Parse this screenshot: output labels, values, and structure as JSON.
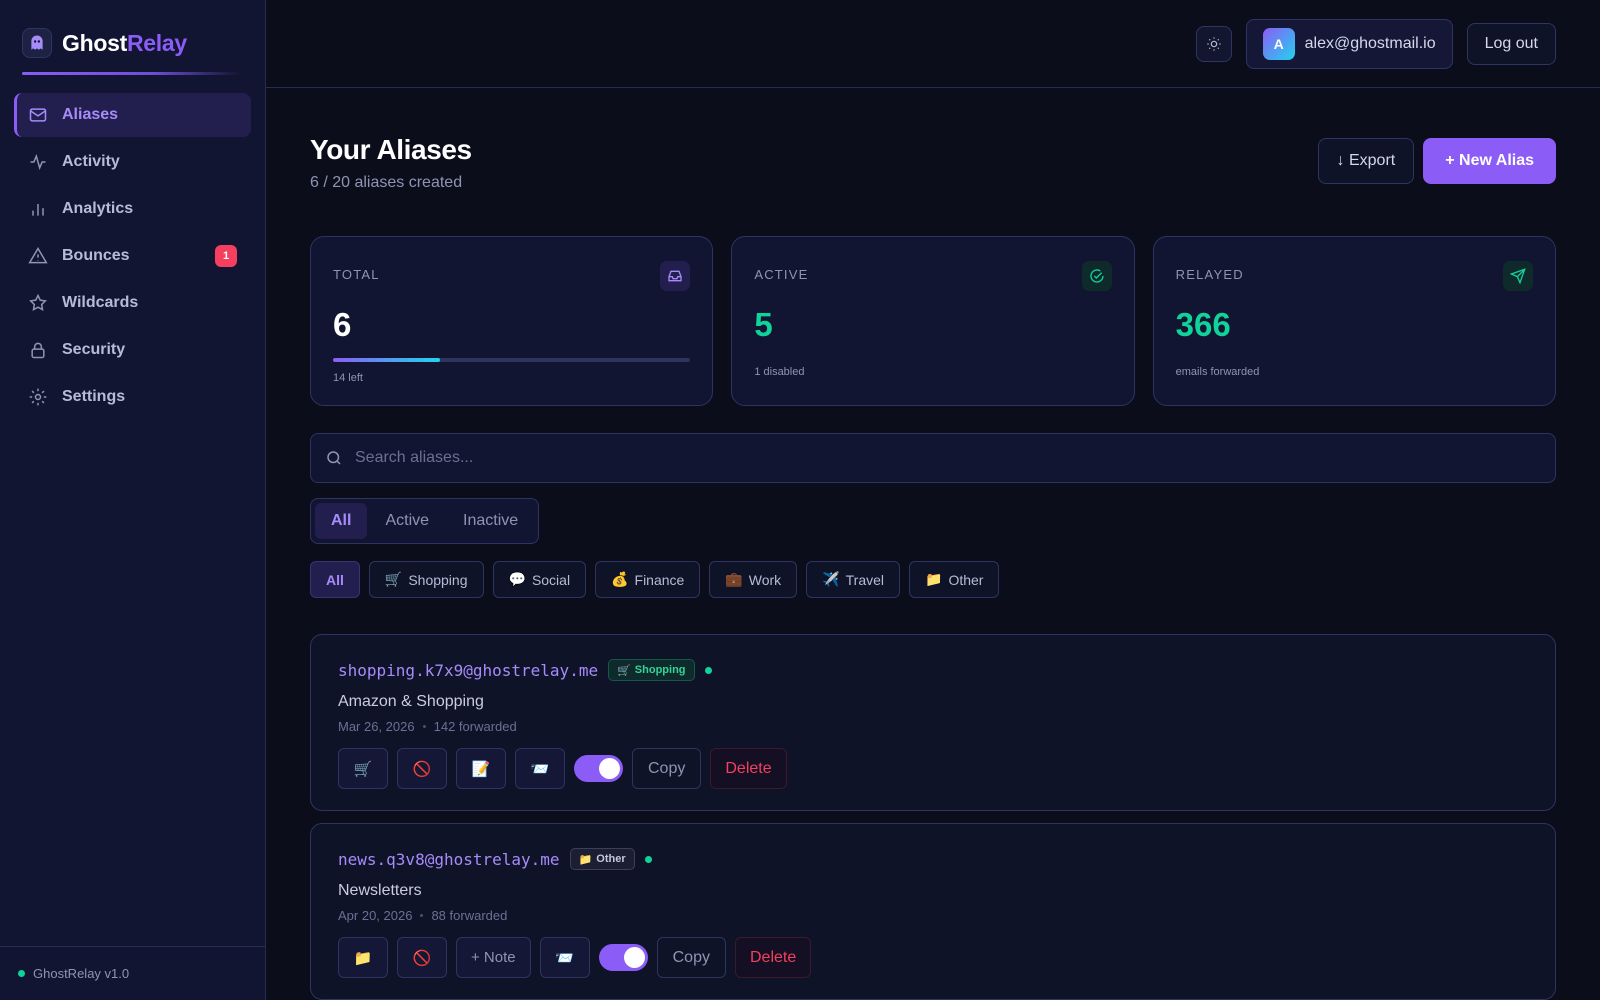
{
  "brand": {
    "name_a": "Ghost",
    "name_b": "Relay"
  },
  "sidebar": {
    "items": [
      {
        "label": "Aliases"
      },
      {
        "label": "Activity"
      },
      {
        "label": "Analytics"
      },
      {
        "label": "Bounces",
        "badge": "1"
      },
      {
        "label": "Wildcards"
      },
      {
        "label": "Security"
      },
      {
        "label": "Settings"
      }
    ],
    "version": "GhostRelay v1.0"
  },
  "header": {
    "user_initial": "A",
    "user_email": "alex@ghostmail.io",
    "logout_label": "Log out"
  },
  "page": {
    "title": "Your Aliases",
    "subtitle": "6 / 20 aliases created",
    "export_label": "↓ Export",
    "new_label": "+ New Alias"
  },
  "stats": {
    "total": {
      "label": "TOTAL",
      "value": "6",
      "note": "14 left",
      "progress": 0.3
    },
    "active": {
      "label": "ACTIVE",
      "value": "5",
      "note": "1 disabled"
    },
    "relayed": {
      "label": "RELAYED",
      "value": "366",
      "note": "emails forwarded"
    }
  },
  "search": {
    "placeholder": "Search aliases..."
  },
  "status_filter": [
    "All",
    "Active",
    "Inactive"
  ],
  "category_filter": [
    {
      "label": "All"
    },
    {
      "emoji": "🛒",
      "label": "Shopping"
    },
    {
      "emoji": "💬",
      "label": "Social"
    },
    {
      "emoji": "💰",
      "label": "Finance"
    },
    {
      "emoji": "💼",
      "label": "Work"
    },
    {
      "emoji": "✈️",
      "label": "Travel"
    },
    {
      "emoji": "📁",
      "label": "Other"
    }
  ],
  "aliases": [
    {
      "email": "shopping.k7x9@ghostrelay.me",
      "tag_emoji": "🛒",
      "tag": "Shopping",
      "description": "Amazon & Shopping",
      "date": "Mar 26, 2026",
      "forwarded": "142 forwarded",
      "actions": [
        "🛒",
        "🚫",
        "📝",
        "📨"
      ],
      "copy": "Copy",
      "delete": "Delete"
    },
    {
      "email": "news.q3v8@ghostrelay.me",
      "tag_emoji": "📁",
      "tag": "Other",
      "description": "Newsletters",
      "date": "Apr 20, 2026",
      "forwarded": "88 forwarded",
      "actions": [
        "📁",
        "🚫",
        "+ Note",
        "📨"
      ],
      "copy": "Copy",
      "delete": "Delete"
    }
  ],
  "colors": {
    "accent": "#8b5cf6",
    "success": "#10d39a",
    "danger": "#f43f5e",
    "bg": "#0b0d1b"
  }
}
